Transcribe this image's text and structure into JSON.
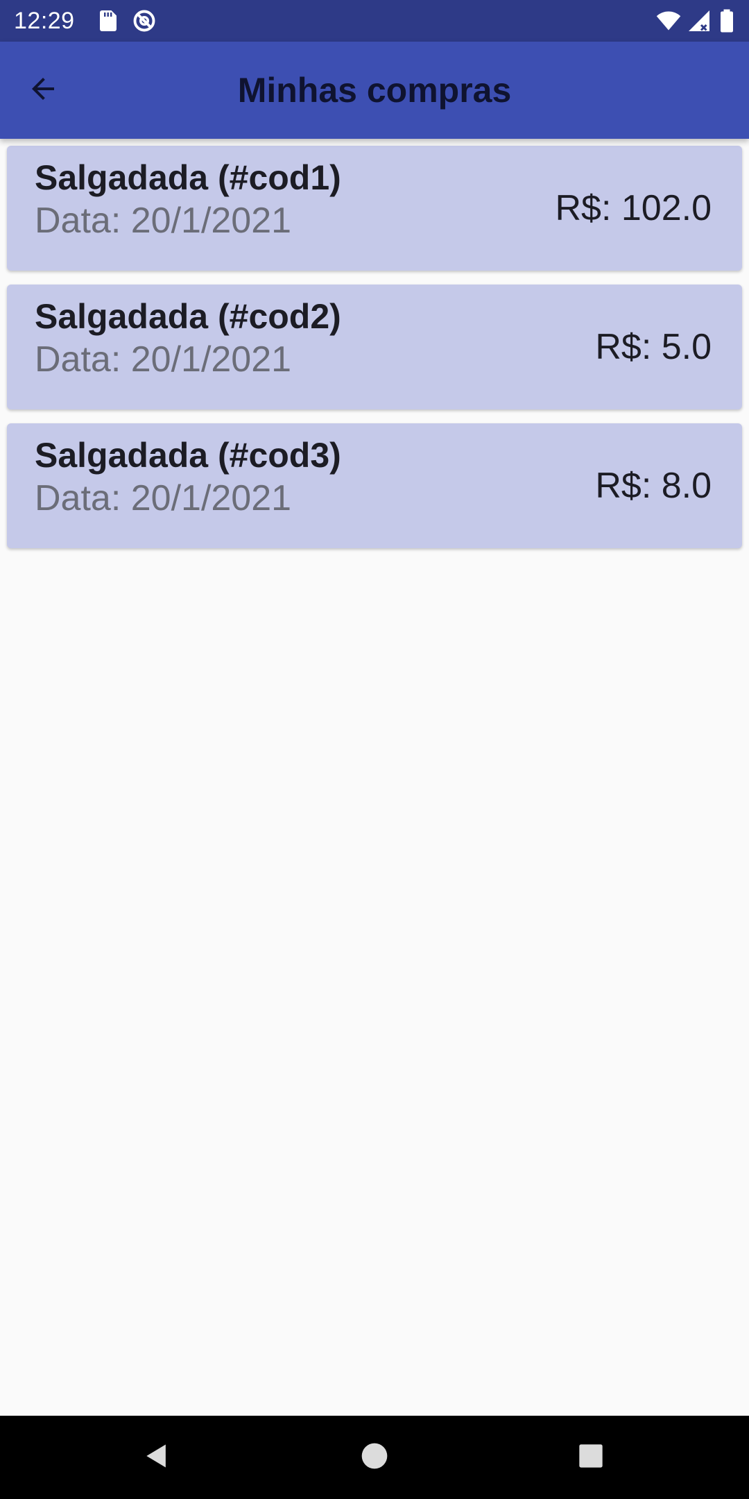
{
  "status_bar": {
    "time": "12:29",
    "left_icons": [
      "sd-card-icon",
      "no-disturb-icon"
    ],
    "right_icons": [
      "wifi-icon",
      "cell-signal-icon",
      "battery-icon"
    ]
  },
  "app_bar": {
    "title": "Minhas compras",
    "back_icon": "arrow-back-icon"
  },
  "purchases": [
    {
      "title": "Salgadada (#cod1)",
      "date": "Data: 20/1/2021",
      "price": "R$: 102.0"
    },
    {
      "title": "Salgadada (#cod2)",
      "date": "Data: 20/1/2021",
      "price": "R$: 5.0"
    },
    {
      "title": "Salgadada (#cod3)",
      "date": "Data: 20/1/2021",
      "price": "R$: 8.0"
    }
  ],
  "nav_bar": {
    "buttons": [
      "back-triangle-icon",
      "home-circle-icon",
      "recents-square-icon"
    ]
  },
  "colors": {
    "status_bar": "#2e3a87",
    "app_bar": "#3d4fb2",
    "card": "#c5c9e9",
    "background": "#fafafa"
  }
}
